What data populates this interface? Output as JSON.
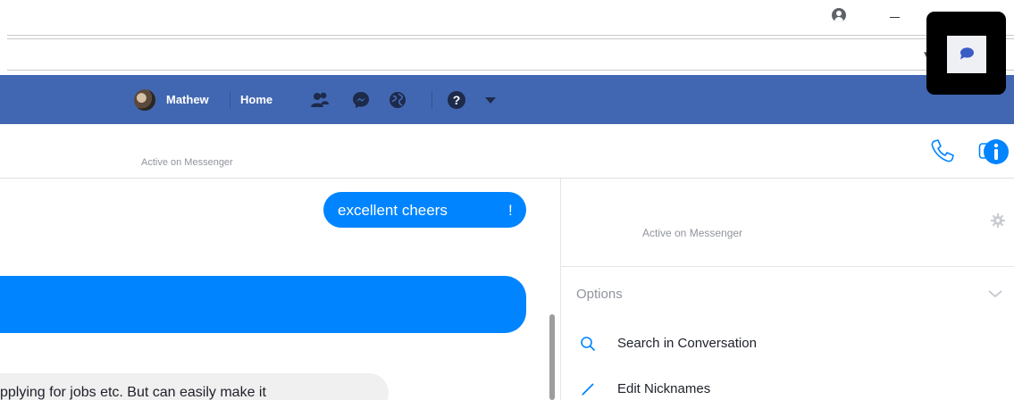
{
  "browser": {
    "account_icon": "account-circle-icon",
    "minimize_icon": "minimize-icon",
    "dropdown_glyph": "▾"
  },
  "overlay": {
    "icon": "chat-bubble-icon"
  },
  "header": {
    "brand_color": "#4267b2",
    "user_name": "Mathew",
    "home_label": "Home",
    "icons": [
      "friend-requests-icon",
      "messenger-icon",
      "notifications-globe-icon",
      "help-icon",
      "caret-down-icon"
    ]
  },
  "conversation": {
    "status": "Active on Messenger",
    "actions": [
      "phone-icon",
      "video-call-icon",
      "info-icon"
    ],
    "accent_color": "#0084ff"
  },
  "messages": [
    {
      "direction": "outgoing",
      "text": "excellent cheers",
      "suffix": "!"
    },
    {
      "direction": "outgoing",
      "text": ""
    },
    {
      "direction": "incoming",
      "text": "pplying for jobs etc. But can easily make it"
    }
  ],
  "info_panel": {
    "status": "Active on Messenger",
    "options_label": "Options",
    "options": [
      {
        "label": "Search in Conversation",
        "icon": "search-icon"
      },
      {
        "label": "Edit Nicknames",
        "icon": "pencil-icon"
      }
    ]
  }
}
